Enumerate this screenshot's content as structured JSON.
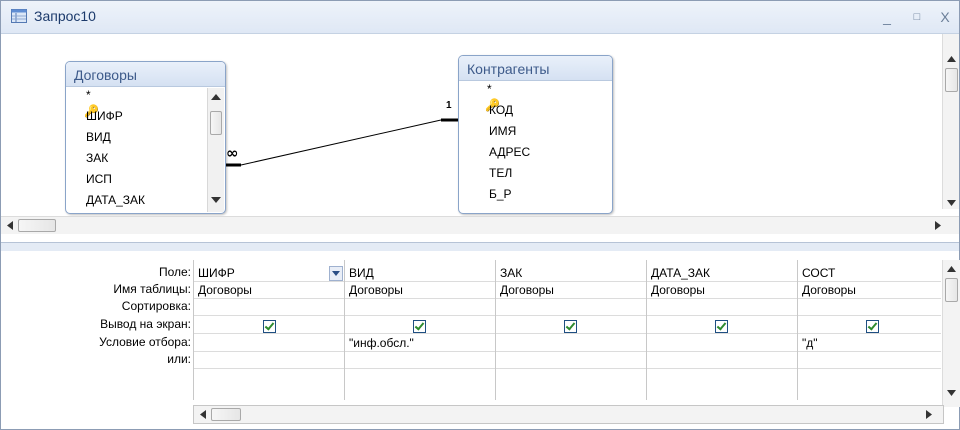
{
  "window": {
    "title": "Запрос10",
    "minimize": "_",
    "maximize": "□",
    "close": "X",
    "icon": "query-icon"
  },
  "tables": [
    {
      "name": "Договоры",
      "fields": [
        "*",
        "ШИФР",
        "ВИД",
        "ЗАК",
        "ИСП",
        "ДАТА_ЗАК"
      ],
      "key_field": "ШИФР"
    },
    {
      "name": "Контрагенты",
      "fields": [
        "*",
        "КОД",
        "ИМЯ",
        "АДРЕС",
        "ТЕЛ",
        "Б_Р"
      ],
      "key_field": "КОД"
    }
  ],
  "relationship": {
    "many_label": "∞",
    "one_label": "1"
  },
  "grid": {
    "row_labels": [
      "Поле:",
      "Имя таблицы:",
      "Сортировка:",
      "Вывод на экран:",
      "Условие отбора:",
      "или:"
    ],
    "columns": [
      {
        "field": "ШИФР",
        "table": "Договоры",
        "sort": "",
        "show": true,
        "criteria": "",
        "or": ""
      },
      {
        "field": "ВИД",
        "table": "Договоры",
        "sort": "",
        "show": true,
        "criteria": "\"инф.обсл.\"",
        "or": ""
      },
      {
        "field": "ЗАК",
        "table": "Договоры",
        "sort": "",
        "show": true,
        "criteria": "",
        "or": ""
      },
      {
        "field": "ДАТА_ЗАК",
        "table": "Договоры",
        "sort": "",
        "show": true,
        "criteria": "",
        "or": ""
      },
      {
        "field": "СОСТ",
        "table": "Договоры",
        "sort": "",
        "show": true,
        "criteria": "\"д\"",
        "or": ""
      }
    ]
  },
  "splitter_grip": "‥‥‥‥"
}
